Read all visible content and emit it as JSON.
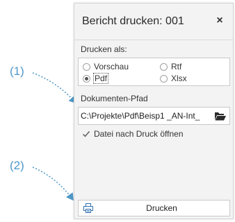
{
  "dialog": {
    "title": "Bericht drucken: 001",
    "close_symbol": "×"
  },
  "print_as": {
    "label": "Drucken als:",
    "options": [
      {
        "label": "Vorschau",
        "selected": false
      },
      {
        "label": "Rtf",
        "selected": false
      },
      {
        "label": "Pdf",
        "selected": true
      },
      {
        "label": "Xlsx",
        "selected": false
      }
    ]
  },
  "document_path": {
    "label": "Dokumenten-Pfad",
    "value": "C:\\Projekte\\Pdf\\Beisp1 _AN-Int_",
    "browse_icon": "folder-open-icon"
  },
  "open_after_print": {
    "label": "Datei nach Druck öffnen",
    "checked": true
  },
  "print_button": {
    "label": "Drucken",
    "icon": "printer-icon"
  },
  "callouts": [
    {
      "label": "(1)"
    },
    {
      "label": "(2)"
    }
  ],
  "colors": {
    "callout": "#4f97c8",
    "panel_bg": "#f3f3f3",
    "border": "#c9c9c9"
  }
}
